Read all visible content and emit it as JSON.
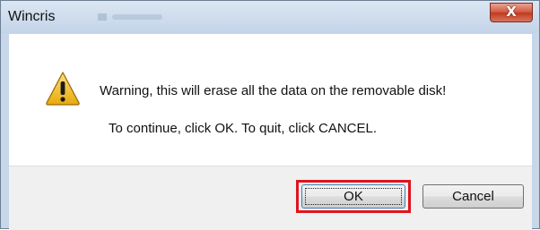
{
  "window": {
    "title": "Wincris",
    "close_glyph": "X"
  },
  "message": {
    "icon": "warning-icon",
    "warning_text": "Warning, this will erase all the data on the removable disk!",
    "instruction_text": "To continue, click OK. To quit, click CANCEL."
  },
  "buttons": {
    "ok_label": "OK",
    "cancel_label": "Cancel"
  },
  "colors": {
    "highlight": "#e0141e",
    "warning_fill": "#f7c52a",
    "close_button": "#c0391f"
  }
}
